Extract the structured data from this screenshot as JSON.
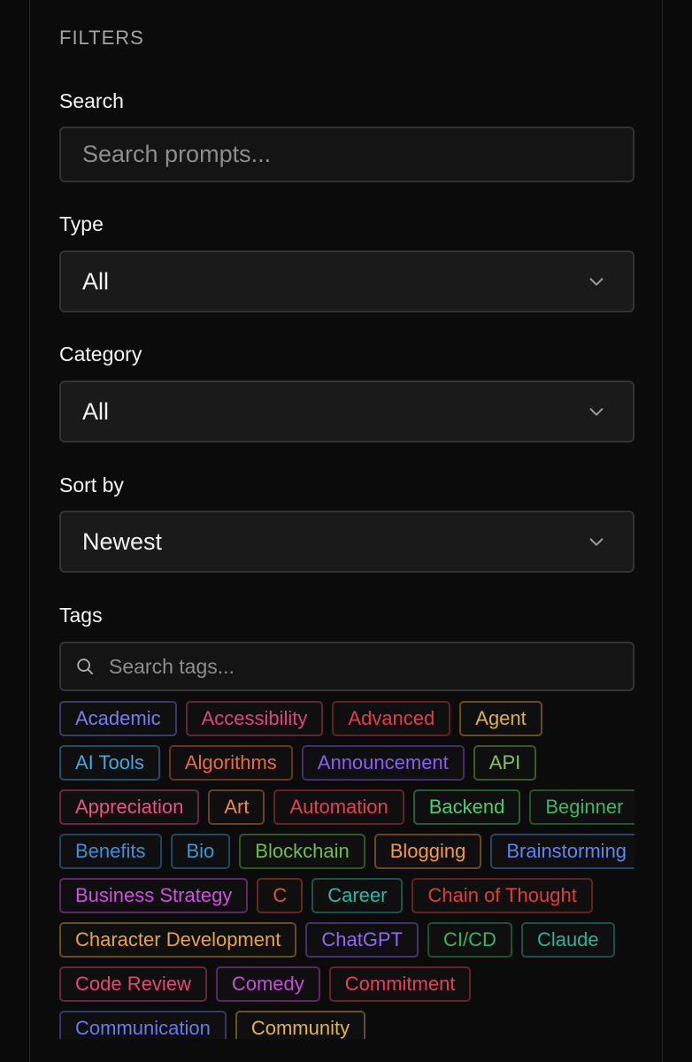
{
  "filters": {
    "heading": "FILTERS",
    "search": {
      "label": "Search",
      "placeholder": "Search prompts..."
    },
    "type": {
      "label": "Type",
      "value": "All"
    },
    "category": {
      "label": "Category",
      "value": "All"
    },
    "sort": {
      "label": "Sort by",
      "value": "Newest"
    },
    "tags_section": {
      "label": "Tags",
      "placeholder": "Search tags..."
    }
  },
  "tags": [
    {
      "label": "Academic",
      "color": "#7b7bf0"
    },
    {
      "label": "Accessibility",
      "color": "#e0457a"
    },
    {
      "label": "Advanced",
      "color": "#e23d4b"
    },
    {
      "label": "Agent",
      "color": "#e0b040"
    },
    {
      "label": "AI Tools",
      "color": "#3fa9e0"
    },
    {
      "label": "Algorithms",
      "color": "#ec6b3b"
    },
    {
      "label": "Announcement",
      "color": "#8b5cf6"
    },
    {
      "label": "API",
      "color": "#84c44b"
    },
    {
      "label": "Appreciation",
      "color": "#f04f82"
    },
    {
      "label": "Art",
      "color": "#f08a3c"
    },
    {
      "label": "Automation",
      "color": "#e6404f"
    },
    {
      "label": "Backend",
      "color": "#4ccf74"
    },
    {
      "label": "Beginner",
      "color": "#3fb65e"
    },
    {
      "label": "Benefits",
      "color": "#3b90d8"
    },
    {
      "label": "Bio",
      "color": "#3a9ad4"
    },
    {
      "label": "Blockchain",
      "color": "#6bc04b"
    },
    {
      "label": "Blogging",
      "color": "#f19a45"
    },
    {
      "label": "Brainstorming",
      "color": "#5c86f0"
    },
    {
      "label": "Business Strategy",
      "color": "#d04fe0"
    },
    {
      "label": "C",
      "color": "#e8532f"
    },
    {
      "label": "Career",
      "color": "#2fb8a4"
    },
    {
      "label": "Chain of Thought",
      "color": "#e33c3c"
    },
    {
      "label": "Character Development",
      "color": "#e8a440"
    },
    {
      "label": "ChatGPT",
      "color": "#9166f5"
    },
    {
      "label": "CI/CD",
      "color": "#35b56a"
    },
    {
      "label": "Claude",
      "color": "#2fae9a"
    },
    {
      "label": "Code Review",
      "color": "#ec4575"
    },
    {
      "label": "Comedy",
      "color": "#c64fd8"
    },
    {
      "label": "Commitment",
      "color": "#ea3e56"
    },
    {
      "label": "Communication",
      "color": "#6b78f0"
    },
    {
      "label": "Community",
      "color": "#e4b43f"
    }
  ]
}
